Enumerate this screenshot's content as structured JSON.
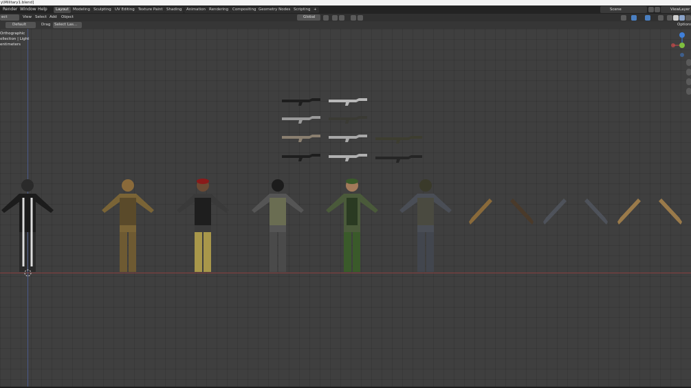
{
  "window": {
    "title": "y\\Military1.blend]"
  },
  "menu": {
    "items": [
      "Render",
      "Window",
      "Help"
    ]
  },
  "workspaces": [
    {
      "label": "Layout",
      "active": true
    },
    {
      "label": "Modeling",
      "active": false
    },
    {
      "label": "Sculpting",
      "active": false
    },
    {
      "label": "UV Editing",
      "active": false
    },
    {
      "label": "Texture Paint",
      "active": false
    },
    {
      "label": "Shading",
      "active": false
    },
    {
      "label": "Animation",
      "active": false
    },
    {
      "label": "Rendering",
      "active": false
    },
    {
      "label": "Compositing",
      "active": false
    },
    {
      "label": "Geometry Nodes",
      "active": false
    },
    {
      "label": "Scripting",
      "active": false
    },
    {
      "label": "+",
      "active": false
    }
  ],
  "scene": {
    "label": "Scene"
  },
  "view_layer": {
    "label": "ViewLayer"
  },
  "header": {
    "mode": "ect Mode",
    "view": "View",
    "select": "Select",
    "add": "Add",
    "object": "Object",
    "transform_orientation": "Global",
    "orientation_default": "Default",
    "drag_label": "Drag",
    "drag_value": "Select Las..."
  },
  "options": {
    "label": "Options"
  },
  "viewport_info": {
    "line1": "Orthographic",
    "line2": "ollection | Light",
    "line3": "entimeters"
  },
  "colors": {
    "x_axis": "#8a4040",
    "y_axis": "#4a5a8a",
    "gizmo_x": "#c94a4a",
    "gizmo_y": "#7fbf3f",
    "gizmo_z": "#3f7fd9"
  }
}
